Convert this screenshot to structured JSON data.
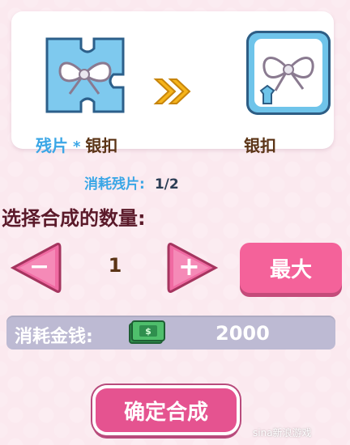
{
  "synthesis": {
    "fragment_star": "*",
    "fragment_prefix": "残片",
    "fragment_item_name": "银扣",
    "result_item_name": "银扣",
    "consume_fragments_label": "消耗残片:",
    "consume_fragments_value": "1/2",
    "select_quantity_title": "选择合成的数量:",
    "quantity_value": "1",
    "max_label": "最大",
    "minus_symbol": "−",
    "plus_symbol": "+",
    "consume_money_label": "消耗金钱:",
    "consume_money_value": "2000",
    "confirm_label": "确定合成"
  },
  "watermark": {
    "text": "sina新浪游戏"
  },
  "colors": {
    "blue_label": "#3aa6e6",
    "brown_text": "#5b3416",
    "pink_button": "#f4629a",
    "money_bar": "#bdbad3"
  },
  "icons": {
    "fragment": "puzzle-bow-icon",
    "arrows": "double-chevron-right-icon",
    "item": "bow-icon",
    "cash": "cash-icon"
  }
}
